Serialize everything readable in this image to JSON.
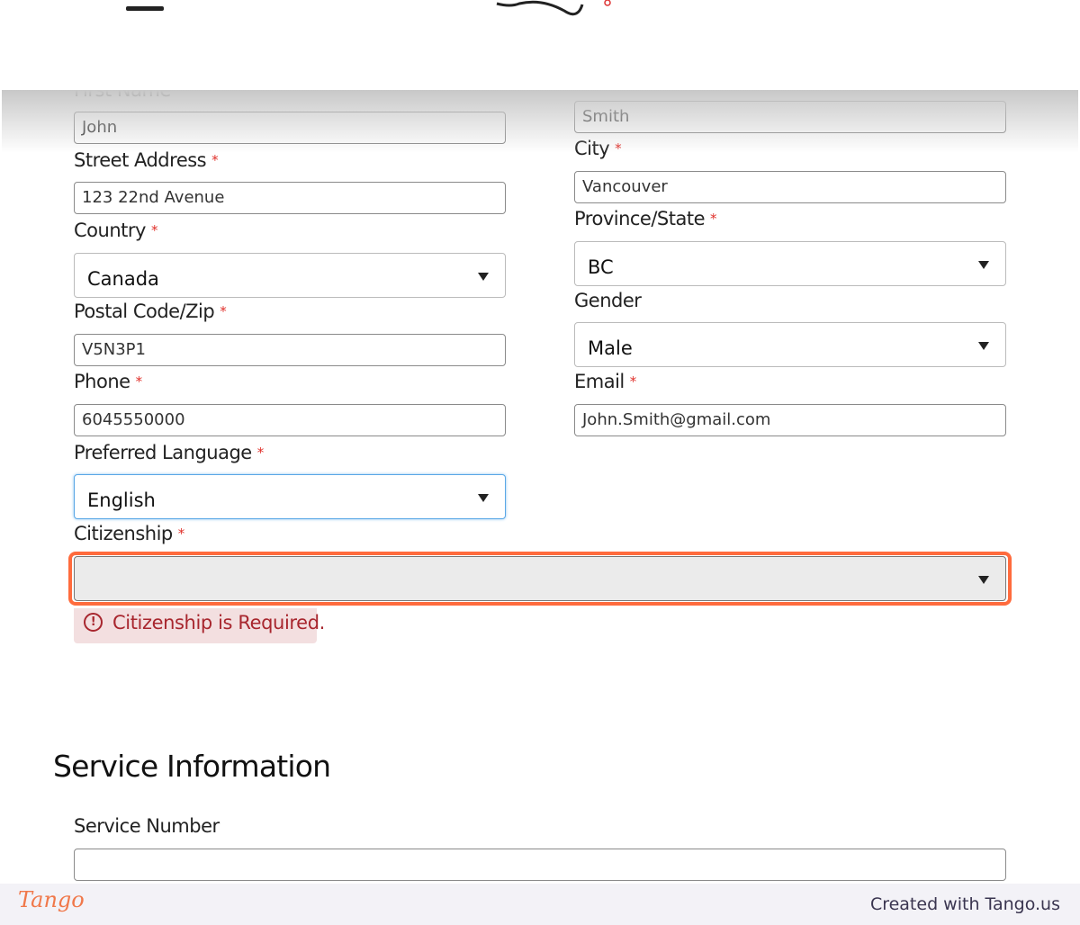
{
  "header": {
    "menu_icon": "hamburger-icon",
    "logo": "signature-logo"
  },
  "form": {
    "first_name": {
      "label": "First Name",
      "value": "John"
    },
    "last_name": {
      "value": "Smith"
    },
    "street": {
      "label": "Street Address",
      "value": "123 22nd Avenue"
    },
    "city": {
      "label": "City",
      "value": "Vancouver"
    },
    "country": {
      "label": "Country",
      "value": "Canada"
    },
    "province": {
      "label": "Province/State",
      "value": "BC"
    },
    "postal": {
      "label": "Postal Code/Zip",
      "value": "V5N3P1"
    },
    "gender": {
      "label": "Gender",
      "value": "Male"
    },
    "phone": {
      "label": "Phone",
      "value": "6045550000"
    },
    "email": {
      "label": "Email",
      "value": "John.Smith@gmail.com"
    },
    "language": {
      "label": "Preferred Language",
      "value": "English"
    },
    "citizenship": {
      "label": "Citizenship",
      "value": "",
      "error": "Citizenship is Required."
    },
    "required_mark": "*"
  },
  "service": {
    "heading": "Service Information",
    "number_label": "Service Number",
    "number_value": ""
  },
  "footer": {
    "logo": "Tango",
    "credit": "Created with Tango.us"
  },
  "colors": {
    "highlight": "#ff6b3d",
    "error_text": "#a8262e",
    "error_bg": "#f3dfe0",
    "focus": "#5aa7e6",
    "required": "#e0302a"
  }
}
